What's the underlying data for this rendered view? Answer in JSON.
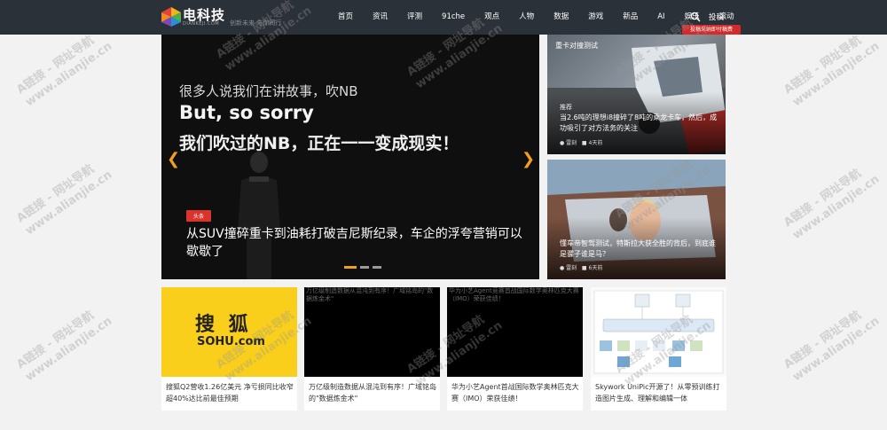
{
  "header": {
    "logo_title": "电科技",
    "logo_sub": "DIANKEJI.COM",
    "slogan": "创新未来 与你同行",
    "nav": [
      "首页",
      "资讯",
      "评测",
      "91che",
      "观点",
      "人物",
      "数据",
      "游戏",
      "新品",
      "AI",
      "娱乐",
      "滚动"
    ],
    "contribute": "投稿",
    "badge": "投稿采纳即付稿费"
  },
  "hero": {
    "line1": "很多人说我们在讲故事，吹NB",
    "line2": "But, so sorry",
    "line3": "我们吹过的NB，正在一一变成现实！",
    "tag": "头条",
    "caption": "从SUV撞碎重卡到油耗打破吉尼斯纪录，车企的浮夸营销可以歇歇了",
    "active_slide": 1,
    "slide_count": 3
  },
  "side_cards": [
    {
      "top_text": "重卡对撞测试",
      "category": "推荐",
      "title": "当2.6吨的理想i8撞碎了8吨的乘龙卡车，然后，成功吸引了对方法务的关注",
      "author": "雷刻",
      "time": "4天前"
    },
    {
      "category": "",
      "title": "懂车帝智驾测试，特斯拉大获全胜的背后，到底谁是骡子谁是马？",
      "author": "雷刻",
      "time": "6天前"
    }
  ],
  "cards": [
    {
      "logo_text": "搜  狐",
      "logo_sub": "SOHU.com",
      "alt": "",
      "title": "搜狐Q2营收1.26亿美元 净亏损同比收窄超40%达比前最佳预期"
    },
    {
      "alt": "万亿级制造数据从混沌到有序！广域铭岛的\"数据炼金术\"",
      "title": "万亿级制造数据从混沌到有序！广域铭岛的\"数据炼金术\""
    },
    {
      "alt": "华为小艺Agent竞赛首战国际数学奥林匹克大赛（IMO）荣获佳绩！",
      "title": "华为小艺Agent首战国际数学奥林匹克大赛（IMO）荣获佳绩！"
    },
    {
      "alt": "",
      "title": "Skywork UniPic开源了！从零预训练打造图片生成、理解和编辑一体"
    }
  ],
  "colors": {
    "topbar": "#2b3138",
    "accent": "#f0a020",
    "tag_red": "#d9332b"
  },
  "watermark": {
    "line1": "A链接 - 网址导航",
    "line2": "www.alianjie.cn"
  }
}
